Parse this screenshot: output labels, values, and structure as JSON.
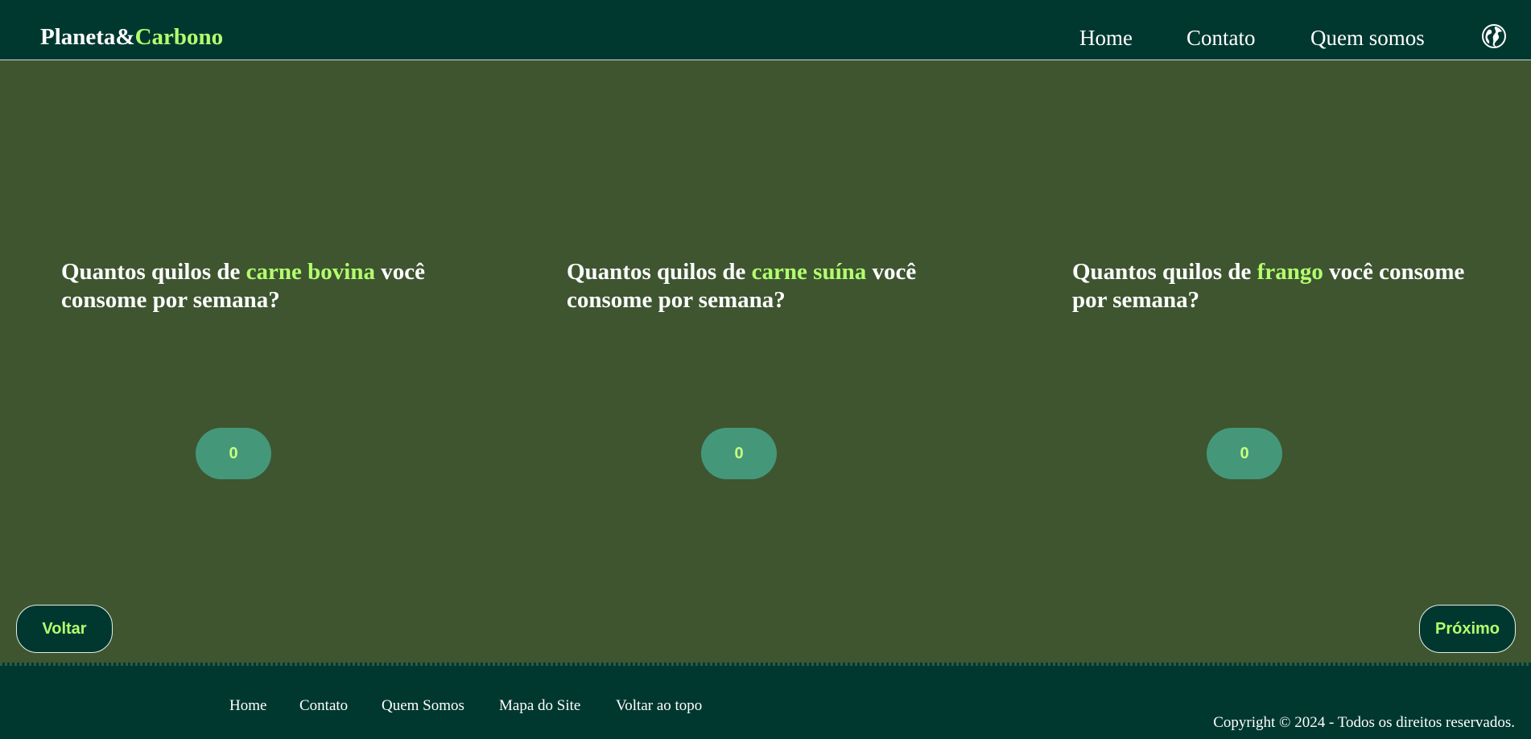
{
  "header": {
    "logo_part1": "Planeta&",
    "logo_part2": "Carbono",
    "nav": [
      "Home",
      "Contato",
      "Quem somos"
    ],
    "globe_icon": "globe-icon"
  },
  "questions": [
    {
      "prefix": "Quantos quilos de ",
      "highlight": "carne bovina",
      "suffix": " você consome por semana?",
      "value": "0"
    },
    {
      "prefix": "Quantos quilos de ",
      "highlight": "carne suína",
      "suffix": " você consome por semana?",
      "value": "0"
    },
    {
      "prefix": "Quantos quilos de ",
      "highlight": "frango",
      "suffix": " você consome por semana?",
      "value": "0"
    }
  ],
  "buttons": {
    "back": "Voltar",
    "next": "Próximo"
  },
  "footer": {
    "links": [
      "Home",
      "Contato",
      "Quem Somos",
      "Mapa do Site",
      "Voltar ao topo"
    ],
    "copyright": "Copyright © 2024 - Todos os direitos reservados."
  },
  "colors": {
    "header_bg": "#003830",
    "main_bg": "#3e5530",
    "accent": "#b3ff6e",
    "pill_bg": "#45977a"
  }
}
